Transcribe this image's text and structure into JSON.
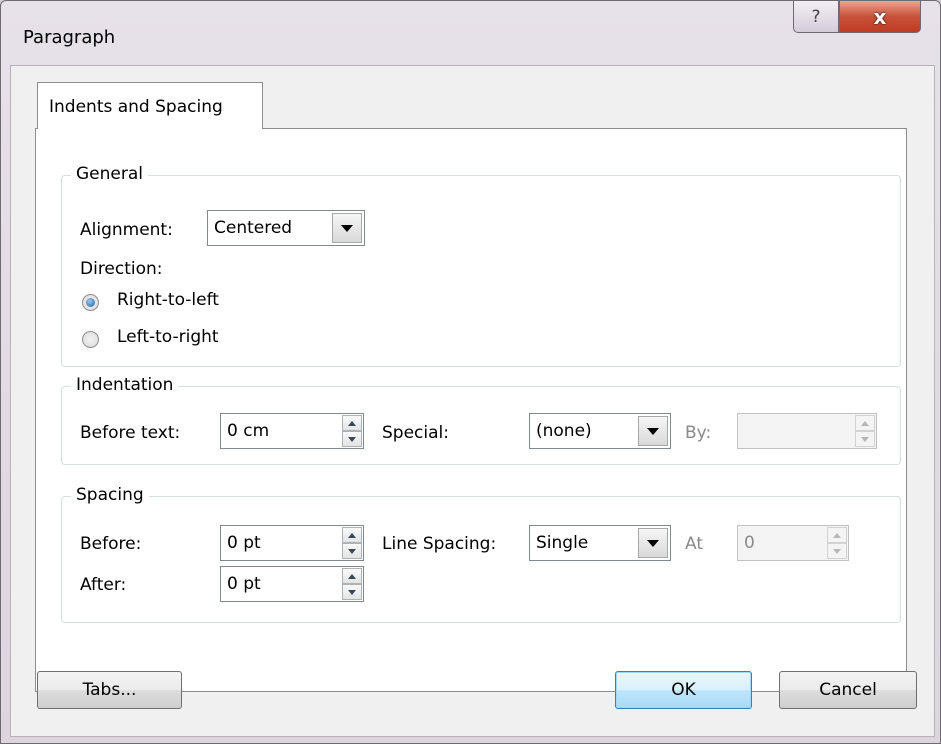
{
  "window": {
    "title": "Paragraph",
    "help_glyph": "?",
    "close_glyph": "x"
  },
  "tabs": [
    {
      "label": "Indents and Spacing",
      "selected": true
    }
  ],
  "general": {
    "group_label": "General",
    "alignment_label": "Alignment:",
    "alignment_value": "Centered",
    "direction_label": "Direction:",
    "direction_options": [
      {
        "label": "Right-to-left",
        "checked": true
      },
      {
        "label": "Left-to-right",
        "checked": false
      }
    ]
  },
  "indentation": {
    "group_label": "Indentation",
    "before_text_label": "Before text:",
    "before_text_value": "0 cm",
    "special_label": "Special:",
    "special_value": "(none)",
    "by_label": "By:",
    "by_value": ""
  },
  "spacing": {
    "group_label": "Spacing",
    "before_label": "Before:",
    "before_value": "0 pt",
    "after_label": "After:",
    "after_value": "0 pt",
    "line_spacing_label": "Line Spacing:",
    "line_spacing_value": "Single",
    "at_label": "At",
    "at_value": "0"
  },
  "buttons": {
    "tabs": "Tabs...",
    "ok": "OK",
    "cancel": "Cancel"
  },
  "colors": {
    "accent": "#3c7fb1",
    "close_red": "#c13b22",
    "disabled_text": "#8a8a8a"
  }
}
